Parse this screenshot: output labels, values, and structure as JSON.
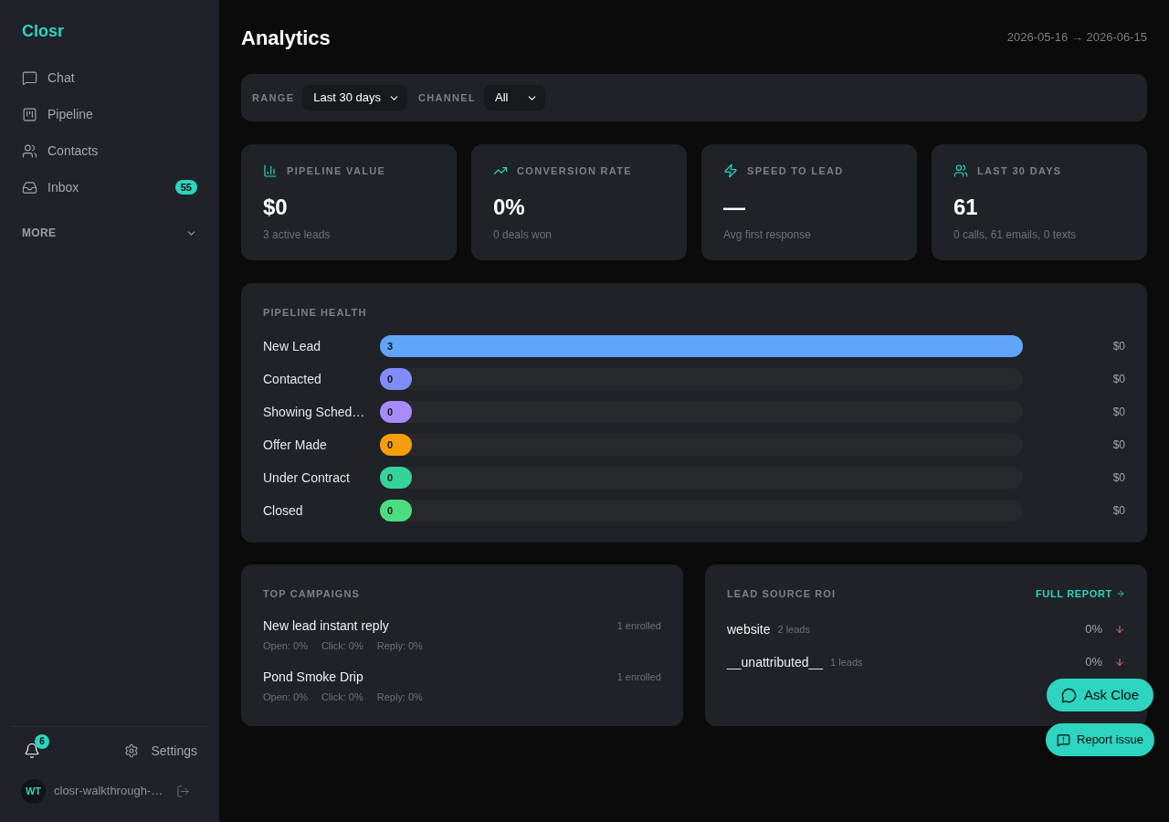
{
  "sidebar": {
    "logo": "Closr",
    "nav_items": [
      {
        "label": "Chat"
      },
      {
        "label": "Pipeline"
      },
      {
        "label": "Contacts"
      },
      {
        "label": "Inbox",
        "badge": "55"
      }
    ],
    "more": {
      "label": "MORE",
      "expanded": false
    },
    "notifications": {
      "count": "6"
    },
    "settings": "Settings",
    "user": {
      "initials": "WT",
      "name": "closr-walkthrough-…"
    }
  },
  "header": {
    "title": "Analytics",
    "date_range": "2026-05-16 → 2026-06-15"
  },
  "filters": [
    {
      "label": "RANGE",
      "value": "Last 30 days"
    },
    {
      "label": "CHANNEL",
      "value": "All"
    }
  ],
  "stats": [
    {
      "label": "PIPELINE VALUE",
      "value": "$0",
      "caption": "3 active leads"
    },
    {
      "label": "CONVERSION RATE",
      "value": "0%",
      "caption": "0 deals won"
    },
    {
      "label": "SPEED TO LEAD",
      "value": "—",
      "caption": "Avg first response"
    },
    {
      "label": "LAST 30 DAYS",
      "value": "61",
      "caption": "0 calls, 61 emails, 0 texts"
    }
  ],
  "pipeline_health": {
    "title": "PIPELINE HEALTH",
    "stages": [
      {
        "name": "New Lead",
        "count": "3",
        "level": 1,
        "color": "#60a5fa",
        "value": "$0"
      },
      {
        "name": "Contacted",
        "count": "0",
        "level": 0,
        "color": "#818cf8",
        "value": "$0"
      },
      {
        "name": "Showing Sched…",
        "count": "0",
        "level": 0,
        "color": "#a78bfa",
        "value": "$0"
      },
      {
        "name": "Offer Made",
        "count": "0",
        "level": 0,
        "color": "#f59e0b",
        "value": "$0"
      },
      {
        "name": "Under Contract",
        "count": "0",
        "level": 0,
        "color": "#34d399",
        "value": "$0"
      },
      {
        "name": "Closed",
        "count": "0",
        "level": 0,
        "color": "#4ade80",
        "value": "$0"
      }
    ]
  },
  "top_campaigns": {
    "title": "TOP CAMPAIGNS",
    "campaigns": [
      {
        "name": "New lead instant reply",
        "enrolled": "1 enrolled",
        "stats": [
          "Open: 0%",
          "Click: 0%",
          "Reply: 0%"
        ]
      },
      {
        "name": "Pond Smoke Drip",
        "enrolled": "1 enrolled",
        "stats": [
          "Open: 0%",
          "Click: 0%",
          "Reply: 0%"
        ]
      }
    ]
  },
  "lead_source_roi": {
    "title": "LEAD SOURCE ROI",
    "link": "FULL REPORT",
    "sources": [
      {
        "name": "website",
        "leads": "2 leads",
        "roi": "0%",
        "trend_down": true
      },
      {
        "name": "__unattributed__",
        "leads": "1 leads",
        "roi": "0%",
        "trend_down": true
      }
    ]
  },
  "floating_buttons": [
    {
      "label": "Ask Cloe"
    },
    {
      "label": "Report issue"
    }
  ]
}
